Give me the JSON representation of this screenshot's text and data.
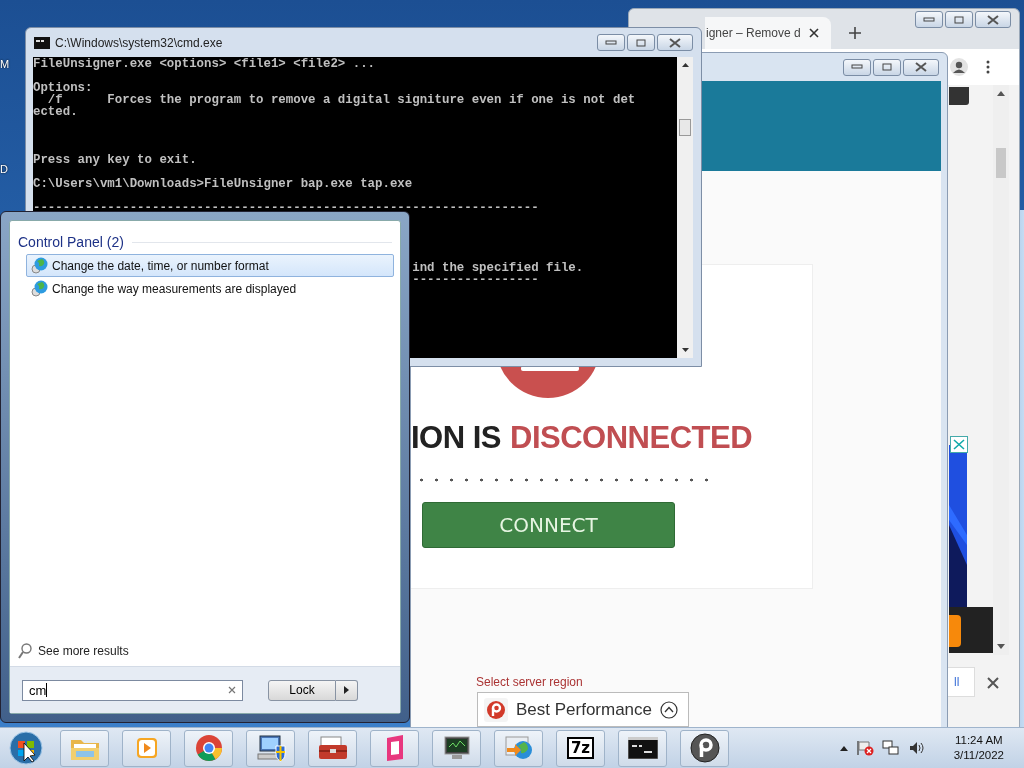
{
  "desktop": {
    "edge_labels": [
      "M",
      "D"
    ]
  },
  "browser": {
    "tab": {
      "title": "igner – Remove d"
    },
    "ad_button": "ll"
  },
  "vpn_window": {
    "connected": false,
    "status_prefix": "ION IS",
    "status_word": "DISCONNECTED",
    "connect_button": "CONNECT",
    "region_label": "Select server region",
    "region_value": "Best Performance"
  },
  "console": {
    "title": "C:\\Windows\\system32\\cmd.exe",
    "lines": [
      {
        "kind": "text",
        "text": "FileUnsigner.exe <options> <file1> <file2> ..."
      },
      {
        "kind": "blank"
      },
      {
        "kind": "text",
        "text": "Options:"
      },
      {
        "kind": "text",
        "text": "  /f      Forces the program to remove a digital signiture even if one is not det"
      },
      {
        "kind": "text",
        "text": "ected."
      },
      {
        "kind": "blank"
      },
      {
        "kind": "blank"
      },
      {
        "kind": "blank"
      },
      {
        "kind": "text",
        "text": "Press any key to exit."
      },
      {
        "kind": "blank"
      },
      {
        "kind": "text",
        "text": "C:\\Users\\vm1\\Downloads>FileUnsigner bap.exe tap.exe"
      },
      {
        "kind": "blank"
      },
      {
        "kind": "text",
        "text": "--------------------------------------------------------------------"
      },
      {
        "kind": "blank"
      },
      {
        "kind": "blank"
      },
      {
        "kind": "blank"
      },
      {
        "kind": "blank"
      },
      {
        "kind": "tail",
        "text": "ind the specified file."
      },
      {
        "kind": "tail",
        "text": "-----------------"
      }
    ]
  },
  "start_menu": {
    "group": "Control Panel (2)",
    "results": [
      {
        "label": "Change the date, time, or number format",
        "selected": true
      },
      {
        "label": "Change the way measurements are displayed",
        "selected": false
      }
    ],
    "more_results": "See more results",
    "search": {
      "value": "cm"
    },
    "lock_button": "Lock"
  },
  "taskbar": {
    "apps": [
      {
        "kind": "folder"
      },
      {
        "kind": "media"
      },
      {
        "kind": "chrome"
      },
      {
        "kind": "computer"
      },
      {
        "kind": "toolbox"
      },
      {
        "kind": "square"
      },
      {
        "kind": "monitor"
      },
      {
        "kind": "globe"
      },
      {
        "kind": "archive",
        "label": "7z"
      },
      {
        "kind": "console"
      },
      {
        "kind": "vpn"
      }
    ],
    "clock": {
      "time": "11:24 AM",
      "date": "3/11/2022"
    }
  }
}
